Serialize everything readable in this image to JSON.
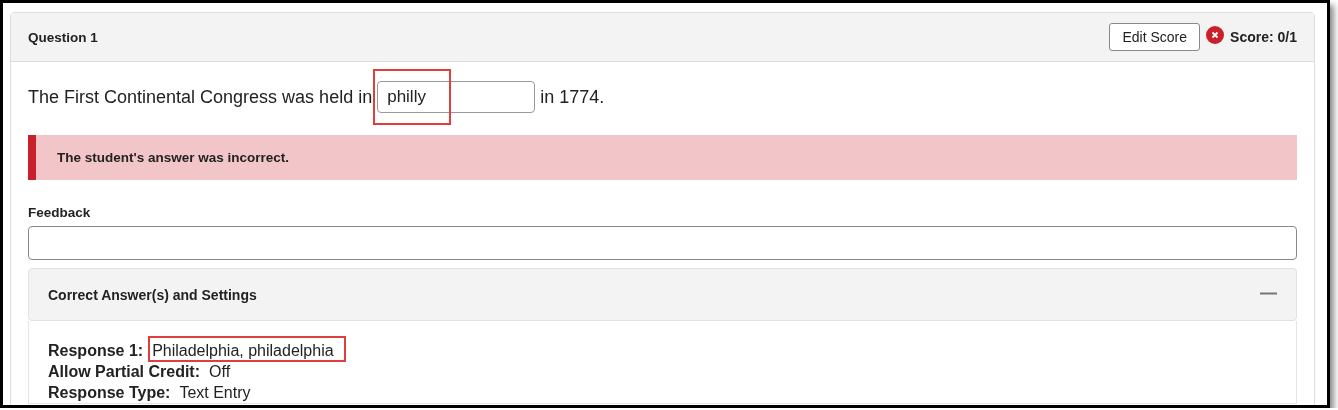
{
  "question": {
    "title": "Question 1",
    "edit_button": "Edit Score",
    "correct": false,
    "score": "Score: 0/1"
  },
  "prompt": {
    "before": "The First Continental Congress was held in",
    "answer": "philly",
    "after": "in 1774.",
    "highlighted": true
  },
  "alert": {
    "text": "The student's answer was incorrect.",
    "kind": "error"
  },
  "feedback": {
    "label": "Feedback"
  },
  "settings": {
    "title": "Correct Answer(s) and Settings",
    "expanded": true,
    "lines": [
      {
        "label": "Response 1:",
        "value": "Philadelphia, philadelphia",
        "highlighted": true
      },
      {
        "label": "Allow Partial Credit:",
        "value": "Off",
        "highlighted": false
      },
      {
        "label": "Response Type:",
        "value": "Text Entry",
        "highlighted": false
      }
    ]
  }
}
